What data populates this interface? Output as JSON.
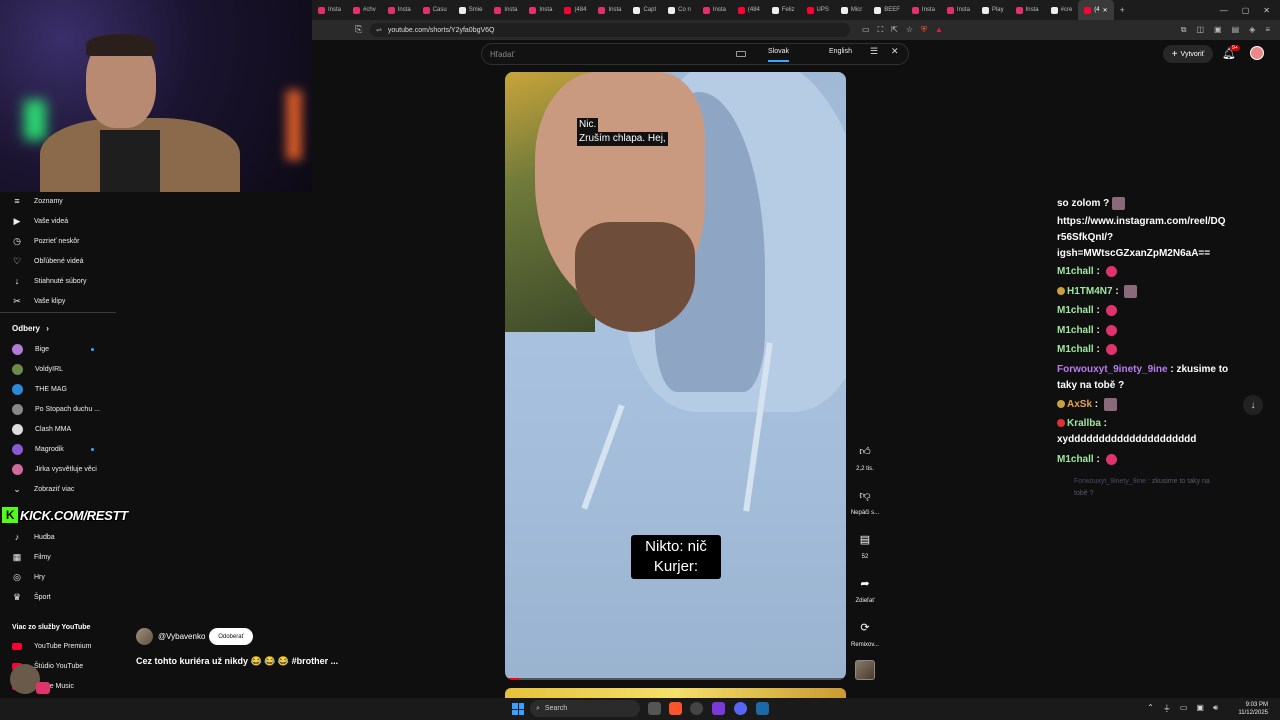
{
  "browser": {
    "tabs": [
      {
        "label": "Insta",
        "fav": "ig"
      },
      {
        "label": "#chv",
        "fav": "ig"
      },
      {
        "label": "Insta",
        "fav": "ig"
      },
      {
        "label": "Casu",
        "fav": "ig"
      },
      {
        "label": "Smie",
        "fav": "tk"
      },
      {
        "label": "Insta",
        "fav": "ig"
      },
      {
        "label": "Insta",
        "fav": "ig"
      },
      {
        "label": "(484",
        "fav": "yt"
      },
      {
        "label": "Insta",
        "fav": "ig"
      },
      {
        "label": "Capt",
        "fav": "tk"
      },
      {
        "label": "Co n",
        "fav": "tk"
      },
      {
        "label": "Insta",
        "fav": "ig"
      },
      {
        "label": "(484",
        "fav": "yt"
      },
      {
        "label": "Feliz",
        "fav": "tk"
      },
      {
        "label": "UPS",
        "fav": "yt"
      },
      {
        "label": "Micr",
        "fav": "tk"
      },
      {
        "label": "BEEF",
        "fav": "tk"
      },
      {
        "label": "Insta",
        "fav": "ig"
      },
      {
        "label": "Insta",
        "fav": "ig"
      },
      {
        "label": "Play",
        "fav": "tk"
      },
      {
        "label": "Insta",
        "fav": "ig"
      },
      {
        "label": "#cre",
        "fav": "tk"
      },
      {
        "label": "(4",
        "fav": "yt",
        "active": true
      }
    ],
    "new_tab": "+",
    "url": "youtube.com/shorts/Y2yfa0bgV6Q"
  },
  "search": {
    "placeholder": "Hľadať",
    "lang_sk": "Slovak",
    "lang_en": "English"
  },
  "header": {
    "create_label": "Vytvoriť",
    "bell_badge": "9+"
  },
  "sidebar": {
    "items": [
      {
        "label": "Zoznamy",
        "icon": "≡",
        "name": "playlists"
      },
      {
        "label": "Vaše videá",
        "icon": "▶",
        "name": "your-videos"
      },
      {
        "label": "Pozrieť neskôr",
        "icon": "◷",
        "name": "watch-later"
      },
      {
        "label": "Obľúbené videá",
        "icon": "♡",
        "name": "liked-videos"
      },
      {
        "label": "Stiahnuté súbory",
        "icon": "↓",
        "name": "downloads"
      },
      {
        "label": "Vaše klipy",
        "icon": "✂",
        "name": "your-clips"
      }
    ],
    "subs_heading": "Odbery",
    "subs": [
      {
        "label": "Bige",
        "color": "#b07ad8",
        "dot": true
      },
      {
        "label": "VoldyIRL",
        "color": "#6a8a4a",
        "dot": false
      },
      {
        "label": "THE MAG",
        "color": "#2a8ad8",
        "dot": false
      },
      {
        "label": "Po Stopach duchu ...",
        "color": "#888888",
        "dot": false
      },
      {
        "label": "Clash MMA",
        "color": "#dddddd",
        "dot": false
      },
      {
        "label": "Magrodik",
        "color": "#8a5ad0",
        "dot": true
      },
      {
        "label": "Jirka vysvětluje věci",
        "color": "#d06a9a",
        "dot": false
      }
    ],
    "show_more": "Zobraziť viac",
    "kick_text": "KICK.COM/RESTT",
    "explore": [
      {
        "label": "Hudba",
        "icon": "♪",
        "name": "music"
      },
      {
        "label": "Filmy",
        "icon": "▦",
        "name": "movies"
      },
      {
        "label": "Hry",
        "icon": "◎",
        "name": "games"
      },
      {
        "label": "Šport",
        "icon": "♛",
        "name": "sport"
      }
    ],
    "more_heading": "Viac zo služby YouTube",
    "more": [
      {
        "label": "YouTube Premium",
        "name": "yt-premium"
      },
      {
        "label": "Štúdio YouTube",
        "name": "yt-studio"
      },
      {
        "label": "uTube Music",
        "name": "yt-music"
      }
    ]
  },
  "video": {
    "subtitle_top_1": "Nic.",
    "subtitle_top_2": "Zruším chlapa. Hej,",
    "subtitle_mid_1": "Nikto: nič",
    "subtitle_mid_2": "Kurjer:",
    "progress_fraction": 0.04
  },
  "rail": {
    "like_count": "2,2 tis.",
    "dislike_label": "Nepáči s...",
    "comment_count": "52",
    "share_label": "Zdieľať",
    "remix_label": "Remixov..."
  },
  "channel": {
    "name": "@Vybavenko",
    "subscribe": "Odoberať",
    "title": "Cez tohto kuriéra už nikdy 😂 😂 😂 #brother ..."
  },
  "chat": {
    "lines": [
      {
        "text": "so zolom ?",
        "emote": "sq"
      },
      {
        "text": "https://www.instagram.com/reel/DQ r56SfkQnI/? igsh=MWtscGZxanZpM2N6aA=="
      },
      {
        "user": "M1chall",
        "ucolor": "green",
        "emote": "dot"
      },
      {
        "user": "H1TM4N7",
        "ucolor": "green",
        "badge": "#c8a040",
        "emote": "sq"
      },
      {
        "user": "M1chall",
        "ucolor": "green",
        "emote": "dot"
      },
      {
        "user": "M1chall",
        "ucolor": "green",
        "emote": "dot"
      },
      {
        "user": "M1chall",
        "ucolor": "green",
        "emote": "dot"
      },
      {
        "user": "Forwouxyt_9inety_9ine",
        "ucolor": "purple",
        "text": "zkusime to taky na tobě ?"
      },
      {
        "user": "AxSk",
        "ucolor": "orange",
        "badge": "#c8a040",
        "emote": "sq"
      },
      {
        "user": "Krallba",
        "ucolor": "green",
        "badge": "#e03030",
        "text": "xyddddddddddddddddddddd"
      },
      {
        "user": "M1chall",
        "ucolor": "green",
        "emote": "dot"
      }
    ],
    "faded_user": "Forwouxyt_9inety_9ine",
    "faded_text": "zkusime to taky na tobě ?"
  },
  "taskbar": {
    "search_label": "Search",
    "time": "9:03 PM",
    "date": "11/12/2025"
  }
}
